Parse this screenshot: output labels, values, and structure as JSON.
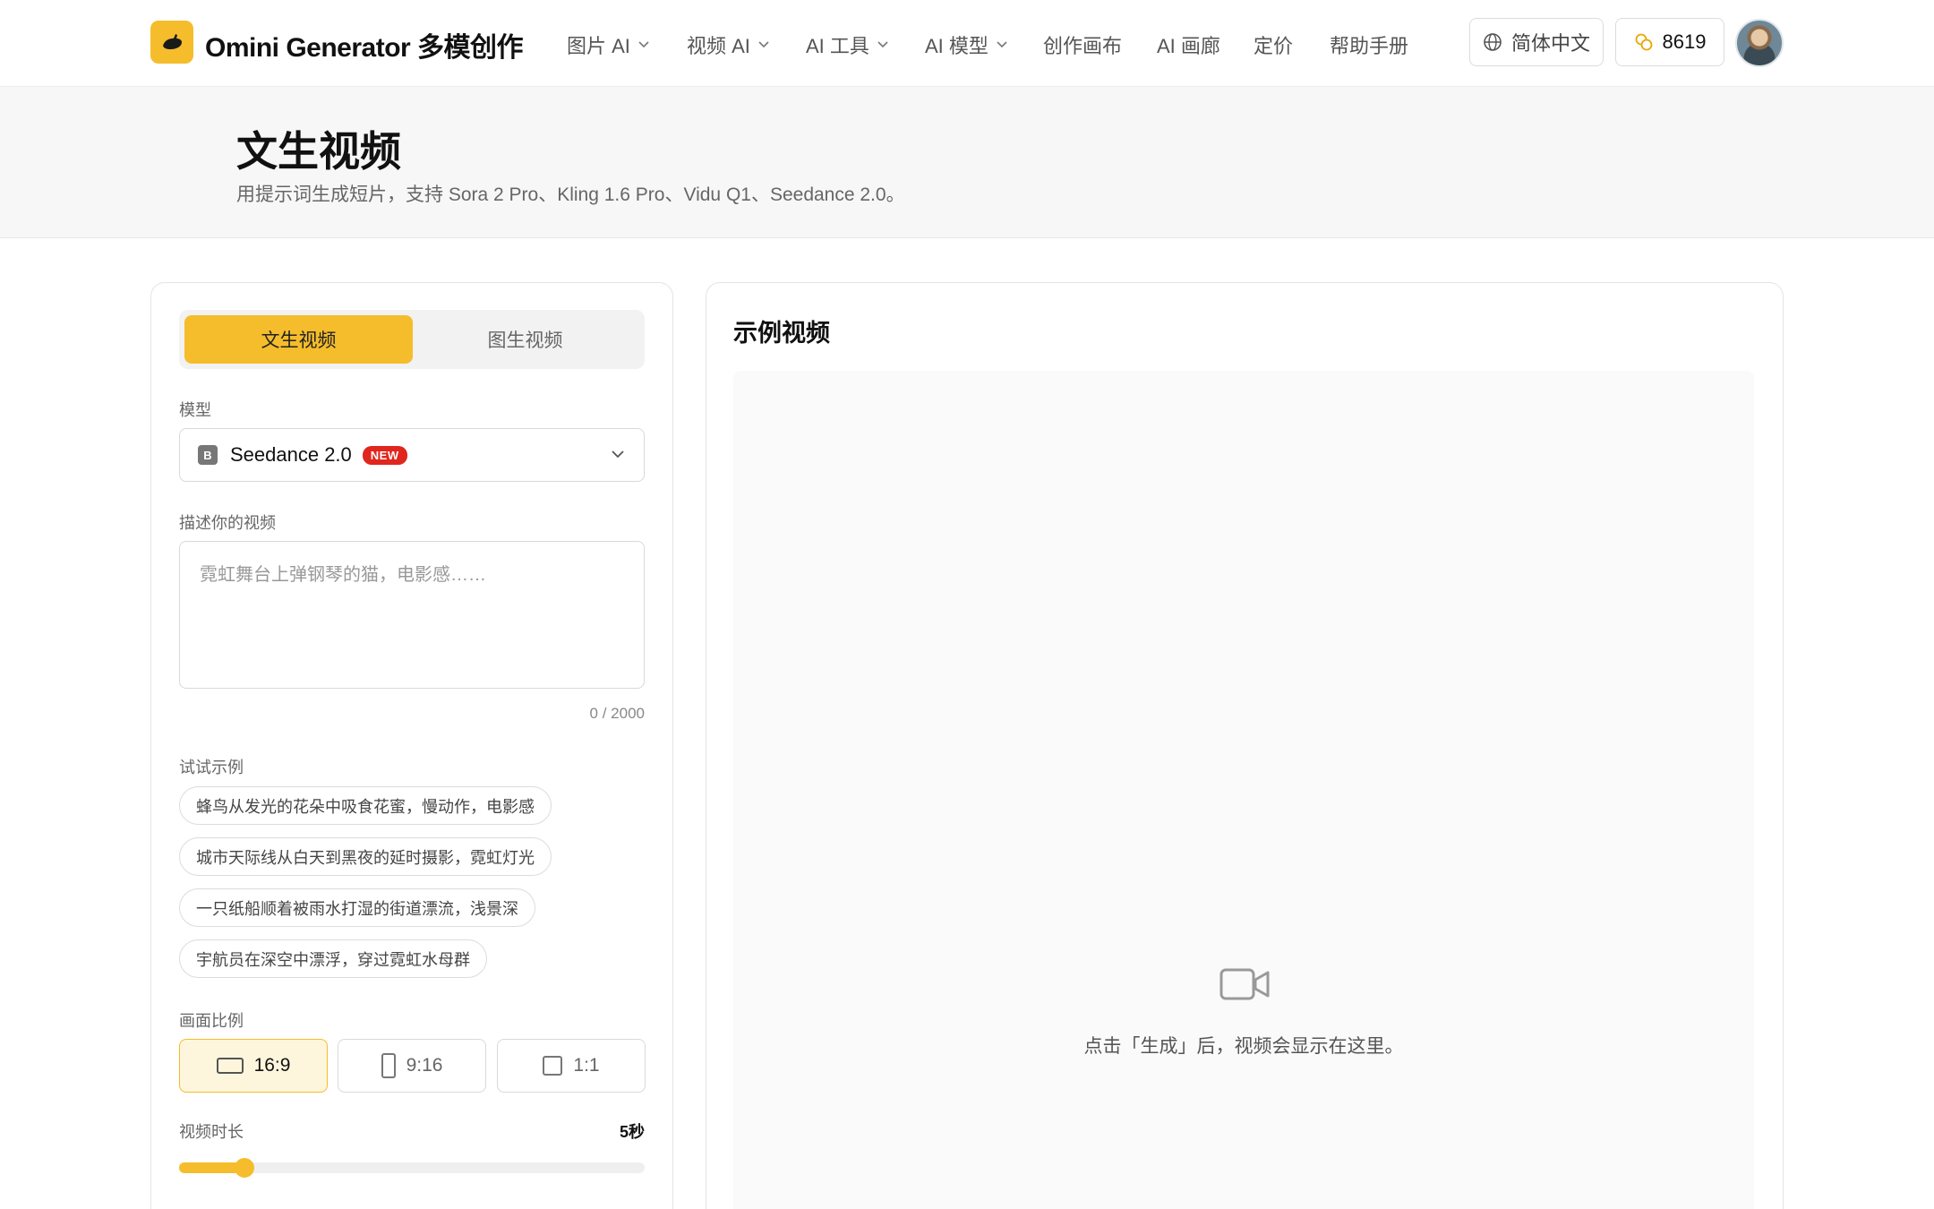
{
  "header": {
    "brand": "Omini Generator 多模创作",
    "nav": [
      {
        "label": "图片 AI",
        "dropdown": true
      },
      {
        "label": "视频 AI",
        "dropdown": true
      },
      {
        "label": "AI 工具",
        "dropdown": true
      },
      {
        "label": "AI 模型",
        "dropdown": true
      },
      {
        "label": "创作画布",
        "dropdown": false
      },
      {
        "label": "AI 画廊",
        "dropdown": false
      },
      {
        "label": "定价",
        "dropdown": false
      },
      {
        "label": "帮助手册",
        "dropdown": false
      }
    ],
    "language": "简体中文",
    "credits": "8619"
  },
  "page": {
    "title": "文生视频",
    "subtitle": "用提示词生成短片，支持 Sora 2 Pro、Kling 1.6 Pro、Vidu Q1、Seedance 2.0。"
  },
  "form": {
    "tabs": [
      "文生视频",
      "图生视频"
    ],
    "active_tab": "文生视频",
    "model_label": "模型",
    "model": {
      "icon_letter": "B",
      "name": "Seedance 2.0",
      "badge": "NEW"
    },
    "prompt_label": "描述你的视频",
    "prompt_value": "",
    "prompt_placeholder": "霓虹舞台上弹钢琴的猫，电影感……",
    "char_count": "0 / 2000",
    "examples_label": "试试示例",
    "examples": [
      "蜂鸟从发光的花朵中吸食花蜜，慢动作，电影感",
      "城市天际线从白天到黑夜的延时摄影，霓虹灯光",
      "一只纸船顺着被雨水打湿的街道漂流，浅景深",
      "宇航员在深空中漂浮，穿过霓虹水母群"
    ],
    "ratio_label": "画面比例",
    "ratios": [
      "16:9",
      "9:16",
      "1:1"
    ],
    "active_ratio": "16:9",
    "duration_label": "视频时长",
    "duration_value": "5秒",
    "duration_fraction": 0.14
  },
  "preview": {
    "title": "示例视频",
    "hint": "点击「生成」后，视频会显示在这里。"
  },
  "colors": {
    "accent": "#f5bd2b",
    "accent_soft": "#fef6dc",
    "badge_red": "#e0261d"
  },
  "icons": {
    "logo": "banana-icon",
    "language": "globe-icon",
    "credits": "coins-icon",
    "dropdown": "chevron-down-icon",
    "preview": "video-camera-icon"
  }
}
